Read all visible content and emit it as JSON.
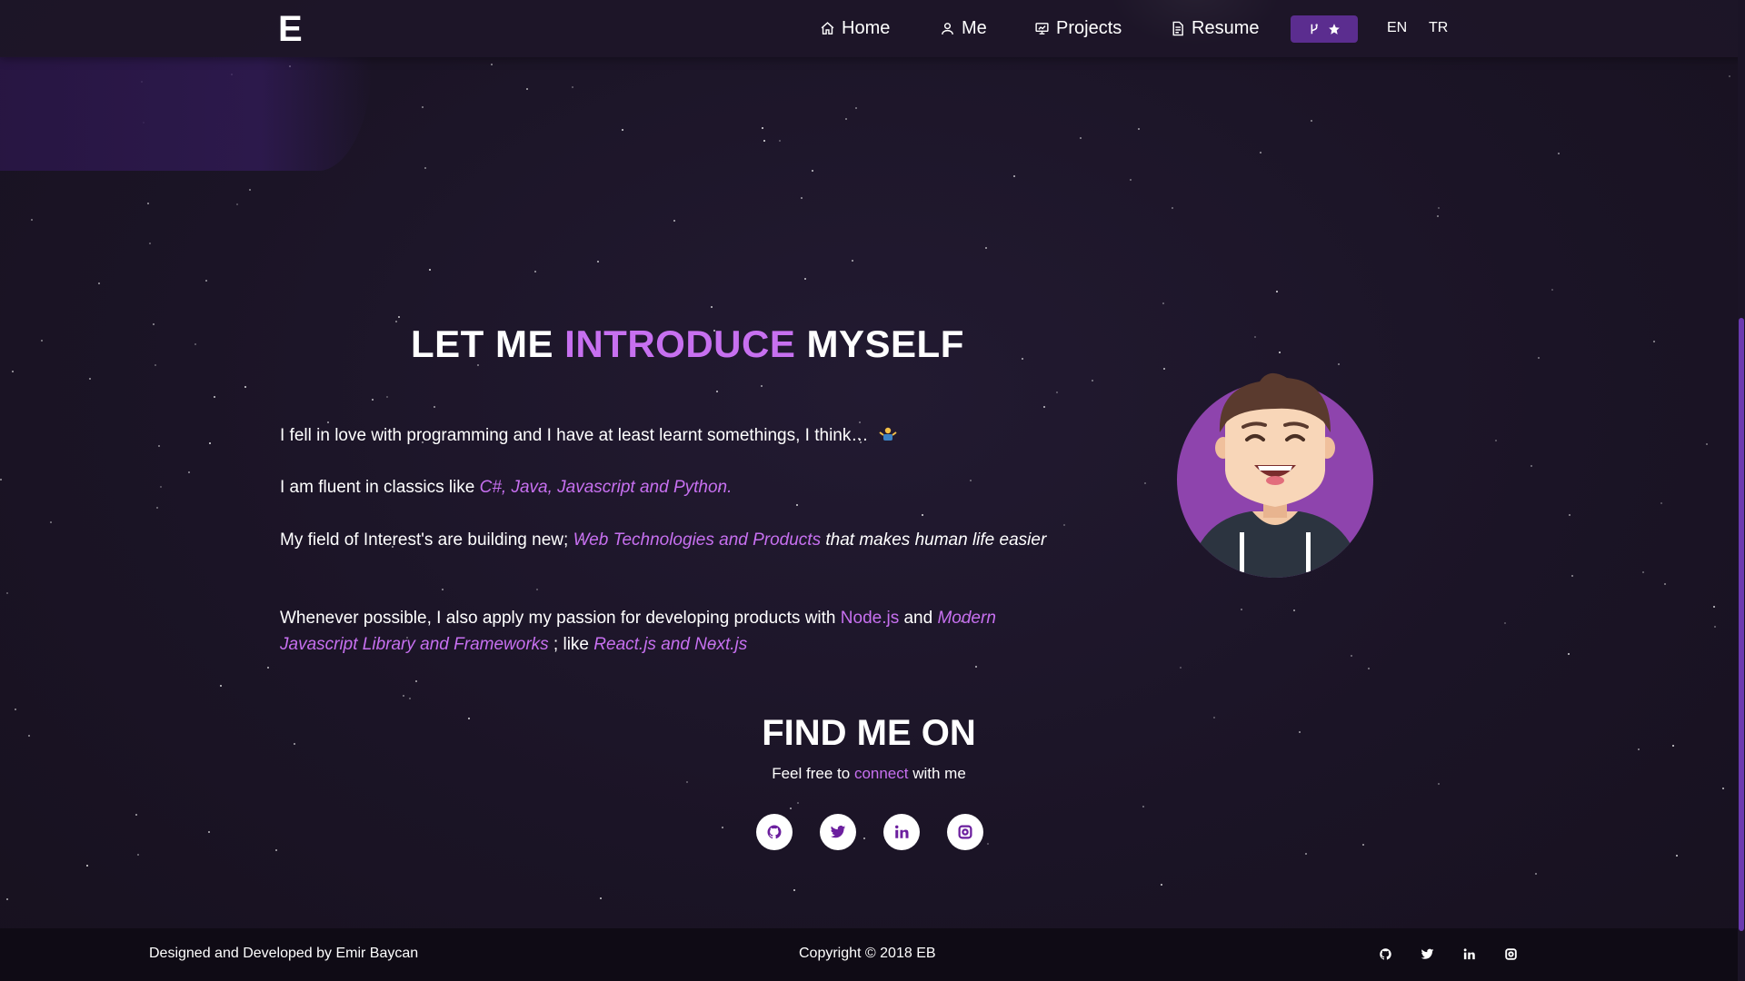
{
  "nav": {
    "logo": "E",
    "items": [
      {
        "label": "Home",
        "icon": "home-icon"
      },
      {
        "label": "Me",
        "icon": "user-icon"
      },
      {
        "label": "Projects",
        "icon": "projects-icon"
      },
      {
        "label": "Resume",
        "icon": "document-icon"
      }
    ],
    "github_button_icons": [
      "git-fork-icon",
      "star-icon"
    ],
    "languages": [
      "EN",
      "TR"
    ]
  },
  "intro": {
    "title_before": "LET ME ",
    "title_highlight": "INTRODUCE",
    "title_after": " MYSELF",
    "p1_text": "I fell in love with programming and I have at least learnt somethings, I think… ",
    "p1_emoji": "person-shrugging-emoji",
    "p2_text": "I am fluent in classics like ",
    "p2_highlight": "C#, Java, Javascript and Python.",
    "p3_text": "My field of Interest's are building new; ",
    "p3_highlight": "Web Technologies and Products",
    "p3_rest": " that makes human life easier",
    "p4_text": "Whenever possible, I also apply my passion for developing products with ",
    "p4_node": "Node.js",
    "p4_and": " and ",
    "p4_frameworks": "Modern Javascript Library and Frameworks",
    "p4_like": " ; like ",
    "p4_react": "React.js and Next.js"
  },
  "find": {
    "title": "FIND ME ON",
    "sub_before": "Feel free to ",
    "sub_highlight": "connect",
    "sub_after": " with me",
    "socials": [
      "github-icon",
      "twitter-icon",
      "linkedin-icon",
      "instagram-icon"
    ]
  },
  "footer": {
    "left": "Designed and Developed by Emir Baycan",
    "center": "Copyright © 2018 EB"
  },
  "colors": {
    "accent": "#c770f0",
    "background": "#1b1426",
    "button": "#5b2d8f",
    "avatar_circle": "#8e44ad"
  }
}
